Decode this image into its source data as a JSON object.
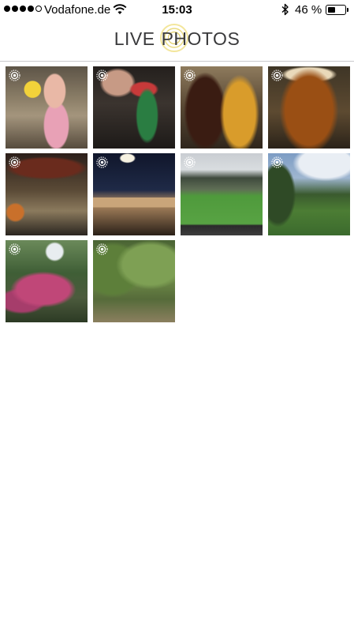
{
  "status_bar": {
    "signal": {
      "filled": 4,
      "total": 5
    },
    "carrier": "Vodafone.de",
    "wifi_icon": "wifi-icon",
    "time": "15:03",
    "bluetooth_icon": "bluetooth-icon",
    "battery_percent_label": "46 %",
    "battery_level": 0.46
  },
  "header": {
    "logo_word_1": "LIVE",
    "logo_word_2": "PHOTOS",
    "logo_ring_color": "#f1e28a"
  },
  "photos": [
    {
      "id": "photo-1",
      "badge_icon": "live-photo-icon",
      "subject": "party"
    },
    {
      "id": "photo-2",
      "badge_icon": "live-photo-icon",
      "subject": "bottle"
    },
    {
      "id": "photo-3",
      "badge_icon": "live-photo-icon",
      "subject": "beer glasses"
    },
    {
      "id": "photo-4",
      "badge_icon": "live-photo-icon",
      "subject": "beer glass"
    },
    {
      "id": "photo-5",
      "badge_icon": "live-photo-icon",
      "subject": "bar interior"
    },
    {
      "id": "photo-6",
      "badge_icon": "live-photo-icon",
      "subject": "stadium entrance"
    },
    {
      "id": "photo-7",
      "badge_icon": "live-photo-icon",
      "subject": "football pitch"
    },
    {
      "id": "photo-8",
      "badge_icon": "live-photo-icon",
      "subject": "park path"
    },
    {
      "id": "photo-9",
      "badge_icon": "live-photo-icon",
      "subject": "flower bush"
    },
    {
      "id": "photo-10",
      "badge_icon": "live-photo-icon",
      "subject": "tree"
    }
  ]
}
